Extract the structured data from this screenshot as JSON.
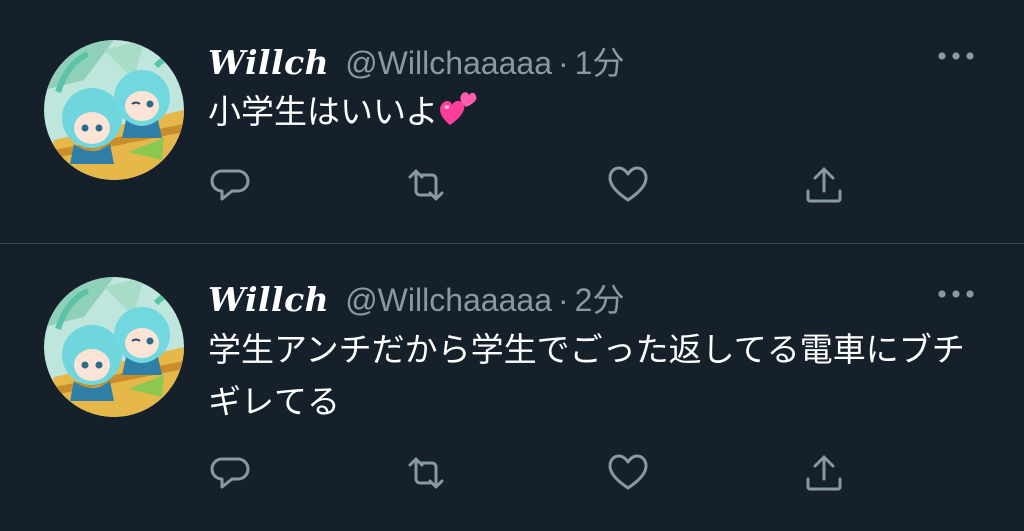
{
  "colors": {
    "background": "#15202b",
    "divider": "#38444d",
    "secondary_text": "#8899a6",
    "primary_text": "#ffffff",
    "heart_emoji": "#ff3d9a"
  },
  "tweets": [
    {
      "display_name": "Willch",
      "handle": "@Willchaaaaa",
      "separator": "·",
      "time": "1分",
      "text": "小学生はいいよ",
      "emoji": "two-hearts-emoji",
      "actions": [
        "reply-icon",
        "retweet-icon",
        "like-icon",
        "share-icon"
      ],
      "more_icon": "more-icon"
    },
    {
      "display_name": "Willch",
      "handle": "@Willchaaaaa",
      "separator": "·",
      "time": "2分",
      "text": "学生アンチだから学生でごった返してる電車にブチギレてる",
      "actions": [
        "reply-icon",
        "retweet-icon",
        "like-icon",
        "share-icon"
      ],
      "more_icon": "more-icon"
    }
  ]
}
